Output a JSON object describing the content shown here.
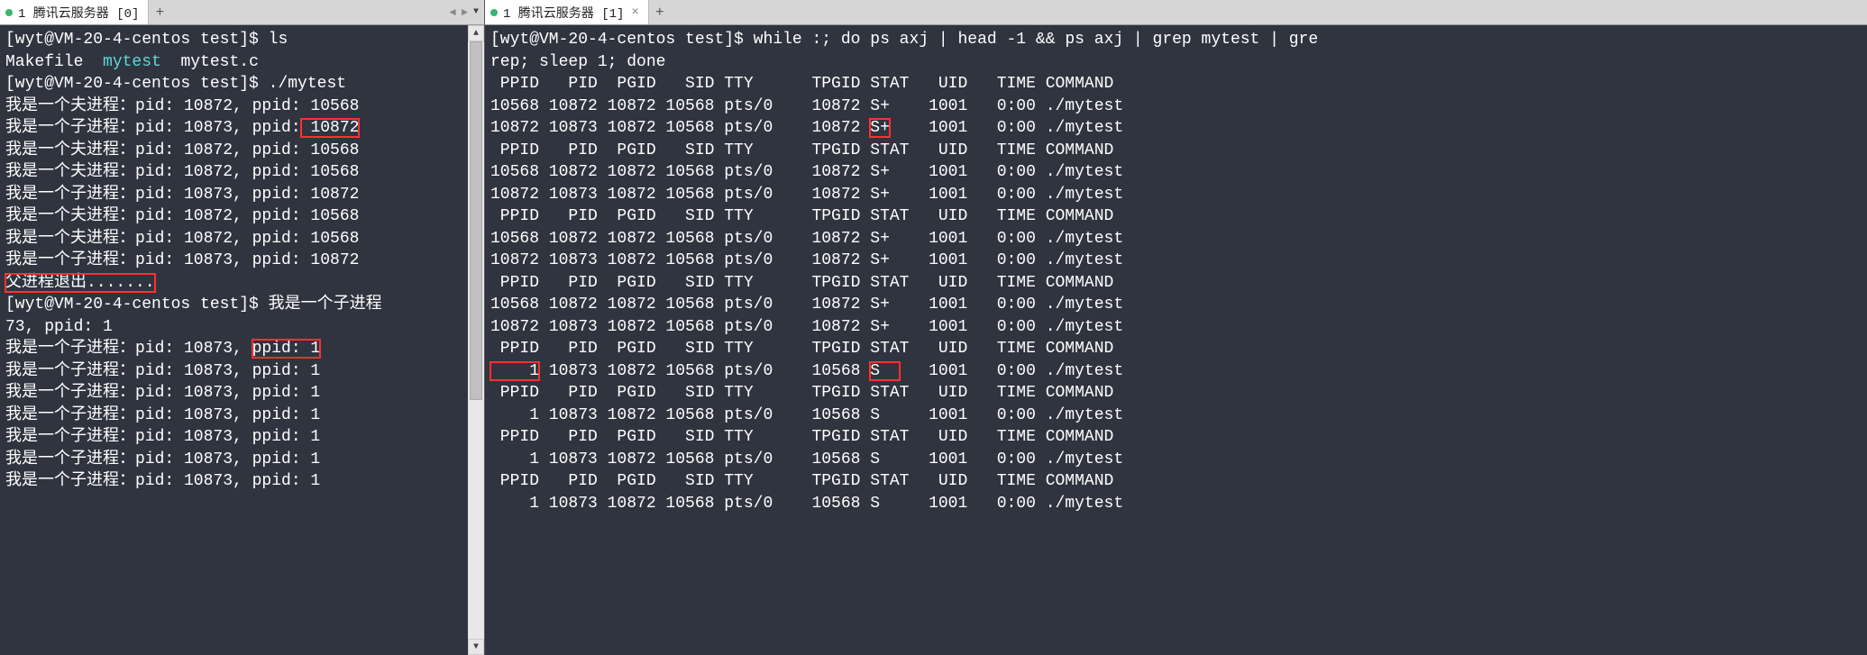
{
  "left": {
    "tab_label": "1 腾讯云服务器 [0]",
    "prompt1": "[wyt@VM-20-4-centos test]$ ",
    "cmd1": "ls",
    "ls_out": {
      "makefile": "Makefile",
      "mytest": "mytest",
      "mytest_c": "mytest.c"
    },
    "cmd2": "./mytest",
    "lines_block1": [
      "我是一个夫进程：pid: 10872, ppid: 10568",
      "我是一个子进程：pid: 10873, ppid:",
      "我是一个夫进程：pid: 10872, ppid: 10568",
      "我是一个夫进程：pid: 10872, ppid: 10568",
      "我是一个子进程：pid: 10873, ppid: 10872",
      "我是一个夫进程：pid: 10872, ppid: 10568",
      "我是一个夫进程：pid: 10872, ppid: 10568",
      "我是一个子进程：pid: 10873, ppid: 10872"
    ],
    "child_ppid_box_val": " 10872",
    "exit_line": "父进程退出.......",
    "prompt2_tail": "我是一个子进程",
    "wrap_line": "73, ppid: 1",
    "child_line_pre": "我是一个子进程：pid: 10873, ",
    "child_line_ppid": "ppid: 1",
    "tail_lines": [
      "我是一个子进程：pid: 10873, ppid: 1",
      "我是一个子进程：pid: 10873, ppid: 1",
      "我是一个子进程：pid: 10873, ppid: 1",
      "我是一个子进程：pid: 10873, ppid: 1",
      "我是一个子进程：pid: 10873, ppid: 1",
      "我是一个子进程：pid: 10873, ppid: 1"
    ]
  },
  "right": {
    "tab_label": "1 腾讯云服务器 [1]",
    "prompt": "[wyt@VM-20-4-centos test]$ ",
    "cmd": "while :; do ps axj | head -1 && ps axj | grep mytest | gre",
    "cmd_wrap": "rep; sleep 1; done",
    "header": " PPID   PID  PGID   SID TTY      TPGID STAT   UID   TIME COMMAND",
    "rows": [
      "10568 10872 10872 10568 pts/0    10872 S+    1001   0:00 ./mytest",
      "10872 10873 10872 10568 pts/0    10872 ",
      "__S+__",
      "    1001   0:00 ./mytest",
      " PPID   PID  PGID   SID TTY      TPGID STAT   UID   TIME COMMAND",
      "10568 10872 10872 10568 pts/0    10872 S+    1001   0:00 ./mytest",
      "10872 10873 10872 10568 pts/0    10872 S+    1001   0:00 ./mytest",
      " PPID   PID  PGID   SID TTY      TPGID STAT   UID   TIME COMMAND",
      "10568 10872 10872 10568 pts/0    10872 S+    1001   0:00 ./mytest",
      "10872 10873 10872 10568 pts/0    10872 S+    1001   0:00 ./mytest",
      " PPID   PID  PGID   SID TTY      TPGID STAT   UID   TIME COMMAND",
      "10568 10872 10872 10568 pts/0    10872 S+    1001   0:00 ./mytest",
      "10872 10873 10872 10568 pts/0    10872 S+    1001   0:00 ./mytest",
      " PPID   PID  PGID   SID TTY      TPGID STAT   UID   TIME COMMAND"
    ],
    "orphan_ppid_boxed": "    1",
    "orphan_rest": " 10873 10872 10568 pts/0    10568 ",
    "orphan_stat_boxed": "S  ",
    "orphan_tail": "   1001   0:00 ./mytest",
    "after": [
      " PPID   PID  PGID   SID TTY      TPGID STAT   UID   TIME COMMAND",
      "    1 10873 10872 10568 pts/0    10568 S     1001   0:00 ./mytest",
      " PPID   PID  PGID   SID TTY      TPGID STAT   UID   TIME COMMAND",
      "    1 10873 10872 10568 pts/0    10568 S     1001   0:00 ./mytest",
      " PPID   PID  PGID   SID TTY      TPGID STAT   UID   TIME COMMAND",
      "    1 10873 10872 10568 pts/0    10568 S     1001   0:00 ./mytest"
    ]
  }
}
